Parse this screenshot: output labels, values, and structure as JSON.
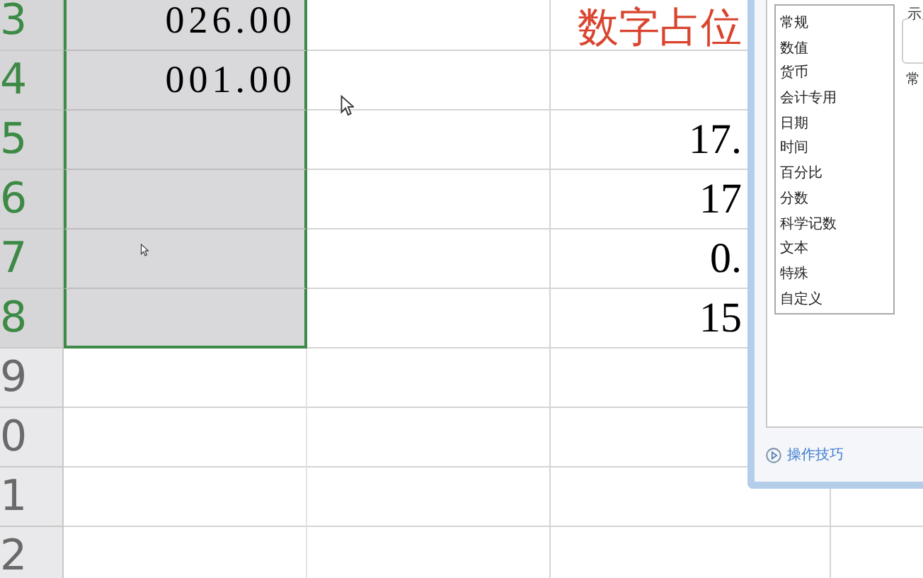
{
  "rows": [
    {
      "number": "3",
      "selected": true,
      "column_2": "026.00",
      "column_4": {
        "text": "数字占位",
        "kind": "heading"
      }
    },
    {
      "number": "4",
      "selected": true,
      "column_2": "001.00"
    },
    {
      "number": "5",
      "selected": true,
      "column_4": {
        "text": "17.",
        "kind": "value"
      }
    },
    {
      "number": "6",
      "selected": true,
      "column_4": {
        "text": "17",
        "kind": "value"
      }
    },
    {
      "number": "7",
      "selected": true,
      "column_4": {
        "text": "0.",
        "kind": "value"
      }
    },
    {
      "number": "8",
      "selected": true,
      "column_4": {
        "text": "15",
        "kind": "value"
      }
    },
    {
      "number": "9",
      "selected": false
    },
    {
      "number": "0",
      "selected": false
    },
    {
      "number": "1",
      "selected": false
    },
    {
      "number": "2",
      "selected": false
    }
  ],
  "dialog": {
    "categories": [
      {
        "label": "常规",
        "selected": false
      },
      {
        "label": "数值",
        "selected": false
      },
      {
        "label": "货币",
        "selected": false
      },
      {
        "label": "会计专用",
        "selected": false
      },
      {
        "label": "日期",
        "selected": false
      },
      {
        "label": "时间",
        "selected": false
      },
      {
        "label": "百分比",
        "selected": false
      },
      {
        "label": "分数",
        "selected": false
      },
      {
        "label": "科学记数",
        "selected": false
      },
      {
        "label": "文本",
        "selected": false
      },
      {
        "label": "特殊",
        "selected": false
      },
      {
        "label": "自定义",
        "selected": false
      }
    ],
    "group_label": "示",
    "label": "常",
    "tips_link": "操作技巧"
  }
}
